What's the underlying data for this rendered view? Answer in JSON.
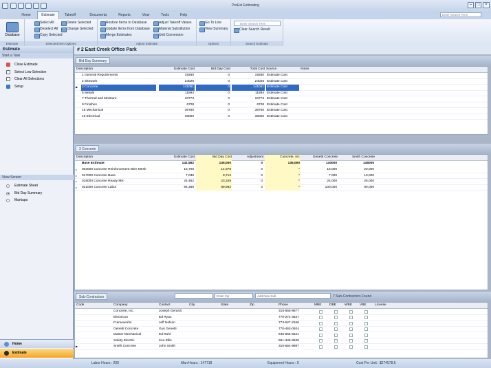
{
  "app": {
    "title": "ProEst Estimating"
  },
  "tabs": [
    "Home",
    "Estimate",
    "Takeoff",
    "Documents",
    "Reports",
    "View",
    "Tools",
    "Help"
  ],
  "search": {
    "placeholder": "Enter Search Term"
  },
  "ribbon": {
    "estimate": {
      "label": "Estimate",
      "button": "Database"
    },
    "selected": {
      "label": "Selected Item Options",
      "items": [
        "Select All",
        "Deselect All",
        "Copy Selected",
        "Delete Selected",
        "Change Selected"
      ]
    },
    "adjust": {
      "label": "Adjust Estimate",
      "items": [
        "Restore Items to Database",
        "Update Items from Database",
        "Merge Estimates",
        "Adjust Takeoff Values",
        "Material Substitution",
        "Unit Conversion"
      ]
    },
    "options": {
      "label": "Options",
      "items": [
        "Go To Line",
        "View Summary"
      ]
    },
    "searchgrp": {
      "label": "Search Estimate",
      "placeholder": "Enter Search Term",
      "clear": "Clear Search Result"
    }
  },
  "left": {
    "title": "Estimate",
    "task_header": "Start a Task",
    "tasks": [
      "Close Estimate",
      "Select Low Selection",
      "Clear All Selections",
      "Setup"
    ],
    "view_header": "View Screen",
    "views": [
      "Estimate Sheet",
      "Bid Day Summary",
      "Markups"
    ],
    "nav": [
      "Home",
      "Estimate"
    ]
  },
  "estimate_header": "# 2  East Creek Office Park",
  "summary": {
    "tab": "Bid Day Summary",
    "columns": [
      "Description",
      "Estimate Cost",
      "Bid Day Cost",
      "Total Cost",
      "Source",
      "Notes"
    ],
    "rows": [
      [
        "1  General Requirements",
        "19260",
        "0",
        "19260",
        "Estimate Cost"
      ],
      [
        "2  Sitework",
        "24026",
        "0",
        "24026",
        "Estimate Cost"
      ],
      [
        "3  Concrete",
        "141061",
        "0",
        "141061",
        "Estimate Cost"
      ],
      [
        "5  Metals",
        "11894",
        "0",
        "11894",
        "Estimate Cost"
      ],
      [
        "7  Thermal and Moisture",
        "10773",
        "0",
        "10773",
        "Estimate Cost"
      ],
      [
        "9  Finishes",
        "6728",
        "0",
        "6728",
        "Estimate Cost"
      ],
      [
        "15  Mechanical",
        "36760",
        "0",
        "36760",
        "Estimate Cost"
      ],
      [
        "16  Electrical",
        "36000",
        "0",
        "36000",
        "Estimate Cost"
      ]
    ]
  },
  "concrete": {
    "tab": "3  Concrete",
    "columns": [
      "Description",
      "Estimate Cost",
      "Bid Day Cost",
      "Adjustment",
      "Concrete, Inc.",
      "Genetti Concrete",
      "Smith Concrete"
    ],
    "base": [
      "Base Estimate",
      "141,562",
      "135,000",
      "0",
      "135,000",
      "140000",
      "145000"
    ],
    "rows": [
      [
        "003000  Concrete Reinforcement Wire Mesh",
        "16,706",
        "14,978",
        "0",
        "*",
        "18,000",
        "20,000"
      ],
      [
        "017000  Concrete Base",
        "7,036",
        "8,712",
        "0",
        "*",
        "7,000",
        "10,000"
      ],
      [
        "018000  Concrete Ready Mix",
        "24,462",
        "23,328",
        "0",
        "*",
        "24,000",
        "26,000"
      ],
      [
        "021000  Concrete Labor",
        "94,366",
        "89,982",
        "0",
        "*",
        "100,000",
        "90,000"
      ]
    ]
  },
  "subs": {
    "tab": "Sub-Contractors",
    "zip_placeholder": "Enter Zip",
    "add_placeholder": "Add New Sub",
    "found": "7  Sub-Contractors Found",
    "columns": [
      "Code",
      "Company",
      "Contact",
      "City",
      "State",
      "Zip",
      "Phone",
      "MBE",
      "DBE",
      "WBE",
      "VBE",
      "License"
    ],
    "rows": [
      [
        "Concrete, Inc.",
        "Joseph Gerardi",
        "315-555-9877"
      ],
      [
        "Electricon",
        "Ed Ryan",
        "770-274-3547"
      ],
      [
        "Frameworks",
        "Jeff Nelson",
        "773-527-2346"
      ],
      [
        "Genetti Concrete",
        "Gus Genetti",
        "770-463-0924"
      ],
      [
        "Master Mechanical",
        "Ed Ruhl",
        "645-965-6621"
      ],
      [
        "Safety Electric",
        "Ken Ellis",
        "551-345-8845"
      ],
      [
        "Smith Concrete",
        "John Smith",
        "315-554-9887"
      ]
    ]
  },
  "status": {
    "labor": "Labor Hours : 200",
    "man": "Man Hours : 147718",
    "equip": "Equipment Hours : 0",
    "cost": "Cost Per Unit : $274578.5"
  },
  "colors": {
    "accent": "#316ac5",
    "nav_active": "#f5a623"
  }
}
